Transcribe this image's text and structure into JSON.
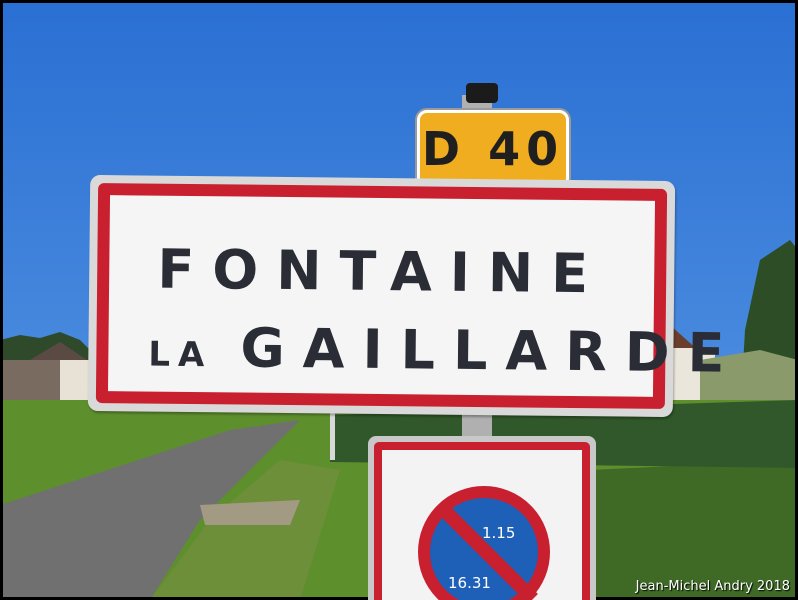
{
  "photo": {
    "route_number": "D 40",
    "town_line1": "FONTAINE",
    "town_line2_prefix": "LA",
    "town_line2_main": "GAILLARDE",
    "parking_time_top": "1.15",
    "parking_time_bottom": "16.31",
    "credit": "Jean-Michel Andry 2018"
  },
  "colors": {
    "sky": "#2f74d6",
    "sign_red": "#c8202f",
    "route_yellow": "#f0ad1f",
    "parking_blue": "#1e5fb8",
    "grass": "#5e8f2d",
    "road": "#6f6f6f"
  }
}
